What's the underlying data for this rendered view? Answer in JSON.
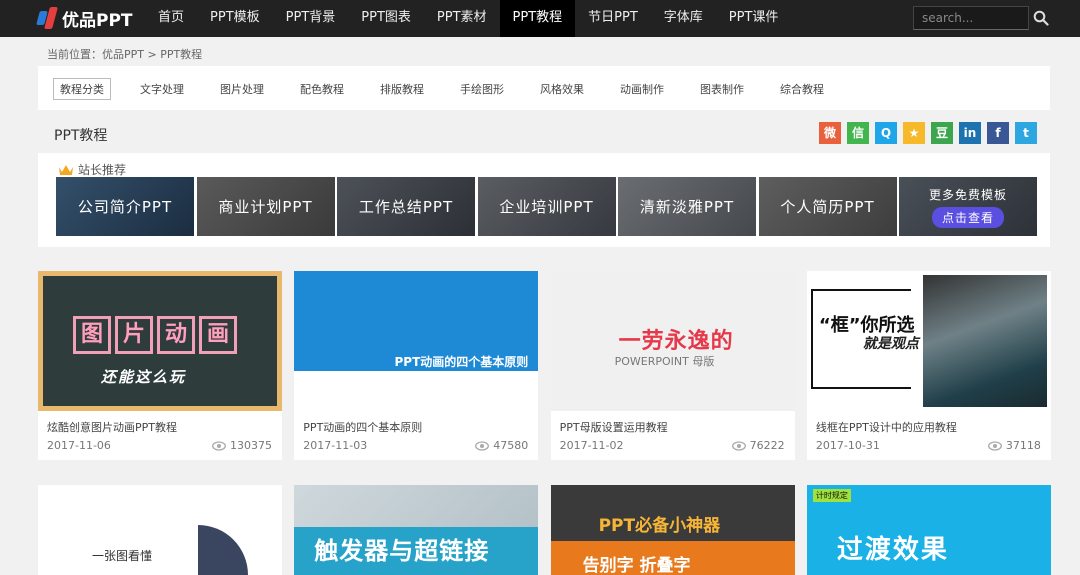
{
  "logo": {
    "text": "优品PPT"
  },
  "nav": {
    "items": [
      "首页",
      "PPT模板",
      "PPT背景",
      "PPT图表",
      "PPT素材",
      "PPT教程",
      "节日PPT",
      "字体库",
      "PPT课件"
    ],
    "active_index": 5
  },
  "search": {
    "placeholder": "search..."
  },
  "breadcrumb": {
    "text": "当前位置：优品PPT > PPT教程"
  },
  "categories": [
    "教程分类",
    "文字处理",
    "图片处理",
    "配色教程",
    "排版教程",
    "手绘图形",
    "风格效果",
    "动画制作",
    "图表制作",
    "综合教程"
  ],
  "section": {
    "title": "PPT教程"
  },
  "share": [
    {
      "name": "weibo-icon",
      "color": "#e9603c",
      "glyph": "微"
    },
    {
      "name": "wechat-icon",
      "color": "#43b54d",
      "glyph": "信"
    },
    {
      "name": "qq-icon",
      "color": "#1ea6e8",
      "glyph": "Q"
    },
    {
      "name": "qzone-icon",
      "color": "#f6b92a",
      "glyph": "★"
    },
    {
      "name": "douban-icon",
      "color": "#3ea54f",
      "glyph": "豆"
    },
    {
      "name": "linkedin-icon",
      "color": "#1d73b0",
      "glyph": "in"
    },
    {
      "name": "facebook-icon",
      "color": "#3a5795",
      "glyph": "f"
    },
    {
      "name": "twitter-icon",
      "color": "#2ea6e0",
      "glyph": "t"
    }
  ],
  "recommend": {
    "title": "站长推荐",
    "banners": [
      "公司简介PPT",
      "商业计划PPT",
      "工作总结PPT",
      "企业培训PPT",
      "清新淡雅PPT",
      "个人简历PPT"
    ],
    "more_title": "更多免费模板",
    "more_button": "点击查看"
  },
  "cards": [
    {
      "title": "炫酷创意图片动画PPT教程",
      "date": "2017-11-06",
      "views": "130375",
      "thumb_words": [
        "图",
        "片",
        "动",
        "画"
      ],
      "thumb_sub": "还能这么玩"
    },
    {
      "title": "PPT动画的四个基本原则",
      "date": "2017-11-03",
      "views": "47580",
      "thumb_text": "PPT动画的四个基本原则"
    },
    {
      "title": "PPT母版设置运用教程",
      "date": "2017-11-02",
      "views": "76222",
      "thumb_text": "一劳永逸的",
      "thumb_sub": "POWERPOINT 母版"
    },
    {
      "title": "线框在PPT设计中的应用教程",
      "date": "2017-10-31",
      "views": "37118",
      "thumb_text": "“框”你所选",
      "thumb_sub": "就是观点"
    }
  ],
  "cards_row2": [
    {
      "thumb_text": "一张图看懂"
    },
    {
      "thumb_text": "触发器与超链接"
    },
    {
      "thumb_text": "PPT必备小神器",
      "thumb_sub": "告别字 折叠字"
    },
    {
      "thumb_text": "过渡效果",
      "thumb_tag": "计时规定"
    }
  ]
}
